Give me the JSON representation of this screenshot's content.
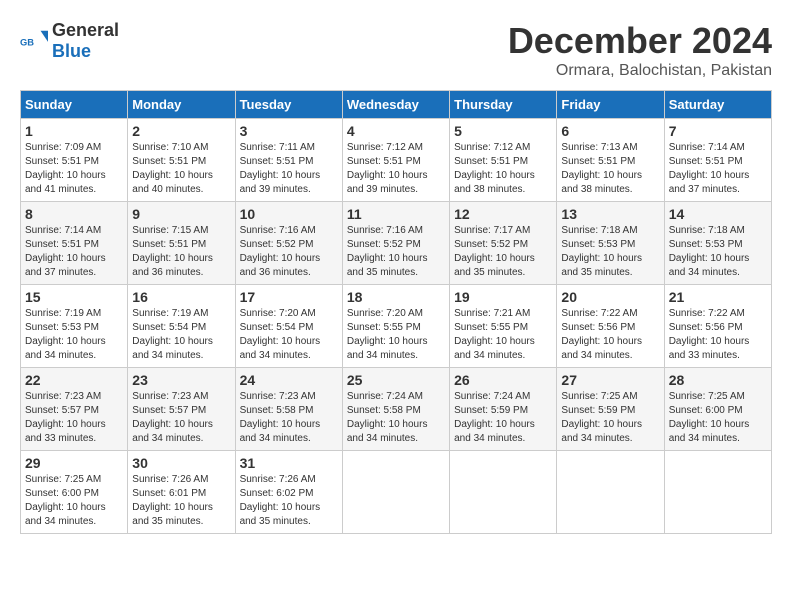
{
  "logo": {
    "text_general": "General",
    "text_blue": "Blue"
  },
  "title": "December 2024",
  "subtitle": "Ormara, Balochistan, Pakistan",
  "weekdays": [
    "Sunday",
    "Monday",
    "Tuesday",
    "Wednesday",
    "Thursday",
    "Friday",
    "Saturday"
  ],
  "weeks": [
    [
      {
        "day": "1",
        "info": "Sunrise: 7:09 AM\nSunset: 5:51 PM\nDaylight: 10 hours\nand 41 minutes."
      },
      {
        "day": "2",
        "info": "Sunrise: 7:10 AM\nSunset: 5:51 PM\nDaylight: 10 hours\nand 40 minutes."
      },
      {
        "day": "3",
        "info": "Sunrise: 7:11 AM\nSunset: 5:51 PM\nDaylight: 10 hours\nand 39 minutes."
      },
      {
        "day": "4",
        "info": "Sunrise: 7:12 AM\nSunset: 5:51 PM\nDaylight: 10 hours\nand 39 minutes."
      },
      {
        "day": "5",
        "info": "Sunrise: 7:12 AM\nSunset: 5:51 PM\nDaylight: 10 hours\nand 38 minutes."
      },
      {
        "day": "6",
        "info": "Sunrise: 7:13 AM\nSunset: 5:51 PM\nDaylight: 10 hours\nand 38 minutes."
      },
      {
        "day": "7",
        "info": "Sunrise: 7:14 AM\nSunset: 5:51 PM\nDaylight: 10 hours\nand 37 minutes."
      }
    ],
    [
      {
        "day": "8",
        "info": "Sunrise: 7:14 AM\nSunset: 5:51 PM\nDaylight: 10 hours\nand 37 minutes."
      },
      {
        "day": "9",
        "info": "Sunrise: 7:15 AM\nSunset: 5:51 PM\nDaylight: 10 hours\nand 36 minutes."
      },
      {
        "day": "10",
        "info": "Sunrise: 7:16 AM\nSunset: 5:52 PM\nDaylight: 10 hours\nand 36 minutes."
      },
      {
        "day": "11",
        "info": "Sunrise: 7:16 AM\nSunset: 5:52 PM\nDaylight: 10 hours\nand 35 minutes."
      },
      {
        "day": "12",
        "info": "Sunrise: 7:17 AM\nSunset: 5:52 PM\nDaylight: 10 hours\nand 35 minutes."
      },
      {
        "day": "13",
        "info": "Sunrise: 7:18 AM\nSunset: 5:53 PM\nDaylight: 10 hours\nand 35 minutes."
      },
      {
        "day": "14",
        "info": "Sunrise: 7:18 AM\nSunset: 5:53 PM\nDaylight: 10 hours\nand 34 minutes."
      }
    ],
    [
      {
        "day": "15",
        "info": "Sunrise: 7:19 AM\nSunset: 5:53 PM\nDaylight: 10 hours\nand 34 minutes."
      },
      {
        "day": "16",
        "info": "Sunrise: 7:19 AM\nSunset: 5:54 PM\nDaylight: 10 hours\nand 34 minutes."
      },
      {
        "day": "17",
        "info": "Sunrise: 7:20 AM\nSunset: 5:54 PM\nDaylight: 10 hours\nand 34 minutes."
      },
      {
        "day": "18",
        "info": "Sunrise: 7:20 AM\nSunset: 5:55 PM\nDaylight: 10 hours\nand 34 minutes."
      },
      {
        "day": "19",
        "info": "Sunrise: 7:21 AM\nSunset: 5:55 PM\nDaylight: 10 hours\nand 34 minutes."
      },
      {
        "day": "20",
        "info": "Sunrise: 7:22 AM\nSunset: 5:56 PM\nDaylight: 10 hours\nand 34 minutes."
      },
      {
        "day": "21",
        "info": "Sunrise: 7:22 AM\nSunset: 5:56 PM\nDaylight: 10 hours\nand 33 minutes."
      }
    ],
    [
      {
        "day": "22",
        "info": "Sunrise: 7:23 AM\nSunset: 5:57 PM\nDaylight: 10 hours\nand 33 minutes."
      },
      {
        "day": "23",
        "info": "Sunrise: 7:23 AM\nSunset: 5:57 PM\nDaylight: 10 hours\nand 34 minutes."
      },
      {
        "day": "24",
        "info": "Sunrise: 7:23 AM\nSunset: 5:58 PM\nDaylight: 10 hours\nand 34 minutes."
      },
      {
        "day": "25",
        "info": "Sunrise: 7:24 AM\nSunset: 5:58 PM\nDaylight: 10 hours\nand 34 minutes."
      },
      {
        "day": "26",
        "info": "Sunrise: 7:24 AM\nSunset: 5:59 PM\nDaylight: 10 hours\nand 34 minutes."
      },
      {
        "day": "27",
        "info": "Sunrise: 7:25 AM\nSunset: 5:59 PM\nDaylight: 10 hours\nand 34 minutes."
      },
      {
        "day": "28",
        "info": "Sunrise: 7:25 AM\nSunset: 6:00 PM\nDaylight: 10 hours\nand 34 minutes."
      }
    ],
    [
      {
        "day": "29",
        "info": "Sunrise: 7:25 AM\nSunset: 6:00 PM\nDaylight: 10 hours\nand 34 minutes."
      },
      {
        "day": "30",
        "info": "Sunrise: 7:26 AM\nSunset: 6:01 PM\nDaylight: 10 hours\nand 35 minutes."
      },
      {
        "day": "31",
        "info": "Sunrise: 7:26 AM\nSunset: 6:02 PM\nDaylight: 10 hours\nand 35 minutes."
      },
      null,
      null,
      null,
      null
    ]
  ]
}
